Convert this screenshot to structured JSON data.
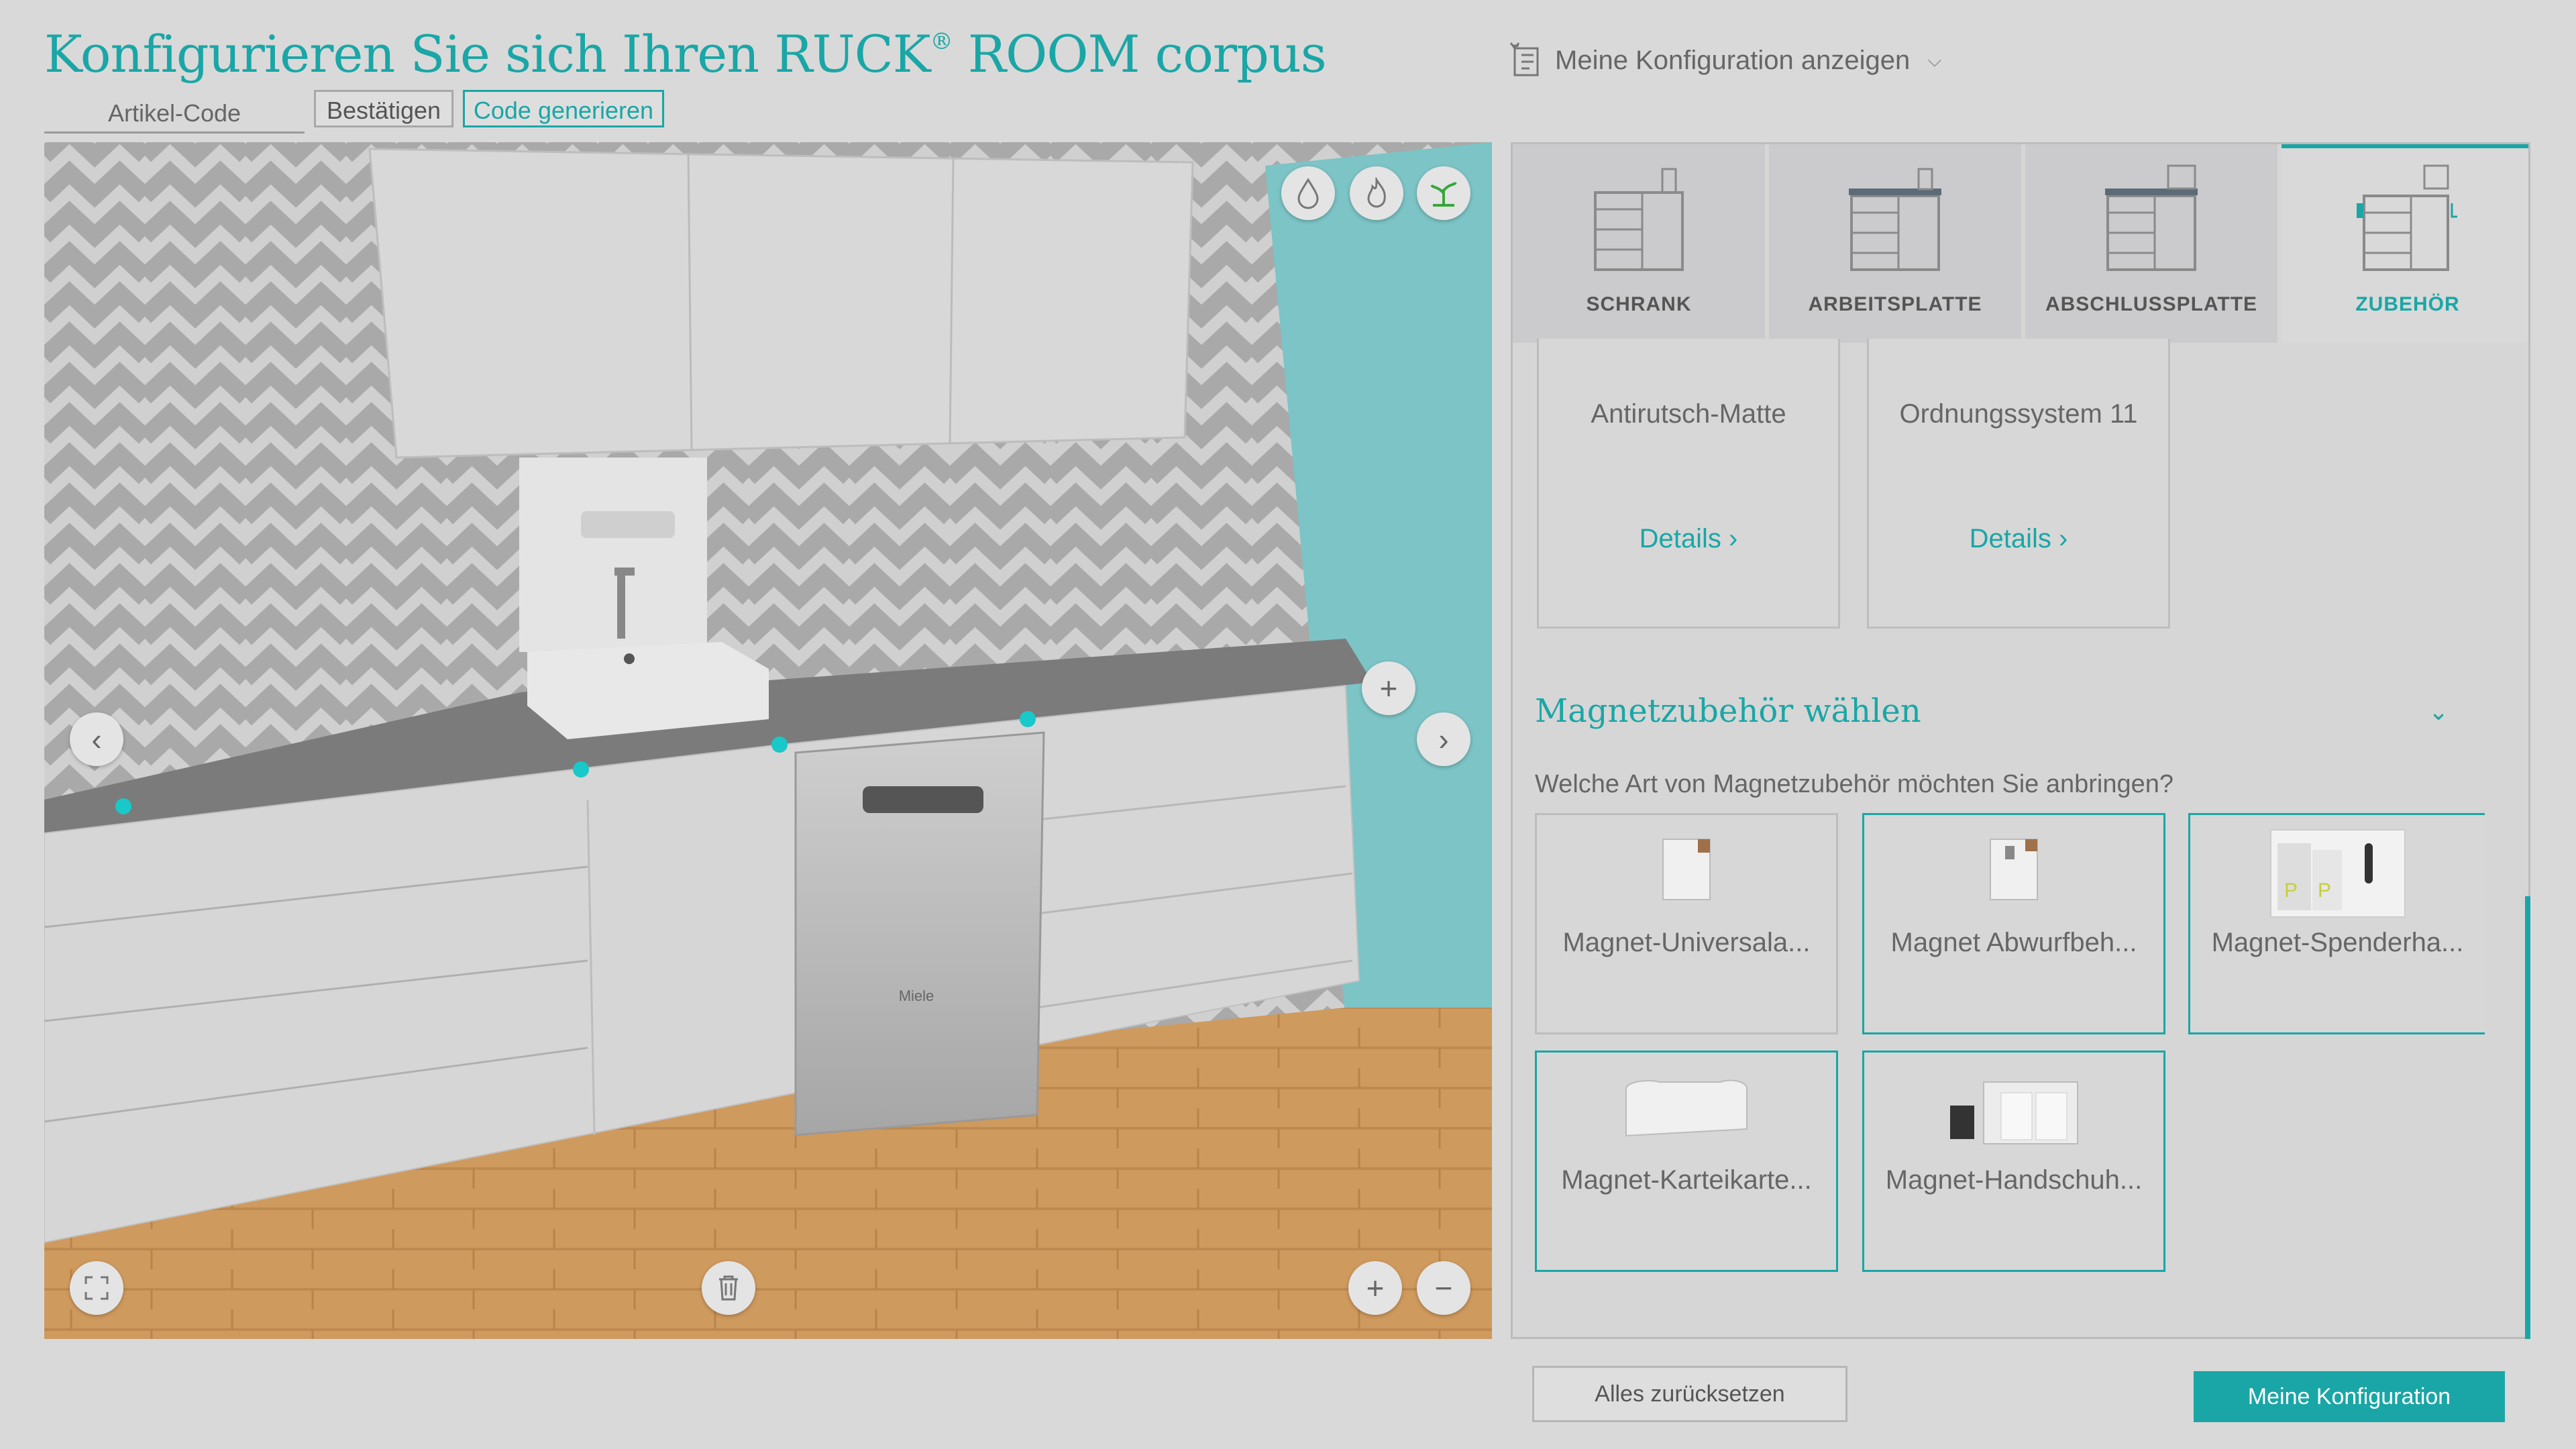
{
  "header": {
    "title_main": "Konfigurieren Sie sich Ihren RUCK",
    "title_reg": "®",
    "title_end": " ROOM corpus",
    "article_code_placeholder": "Artikel-Code",
    "confirm_label": "Bestätigen",
    "generate_code_label": "Code generieren",
    "show_config_label": "Meine Konfiguration anzeigen"
  },
  "viewer": {
    "top_icons": [
      "water-icon",
      "flame-icon",
      "plant-icon"
    ],
    "prev_icon": "chevron-left-icon",
    "next_icon": "chevron-right-icon",
    "add_icon": "plus-icon",
    "fullscreen_icon": "fullscreen-icon",
    "delete_icon": "trash-icon",
    "zoom_in_icon": "zoom-in-icon",
    "zoom_out_icon": "zoom-out-icon",
    "dishwasher_brand": "Miele"
  },
  "tabs": [
    {
      "label": "SCHRANK",
      "active": false
    },
    {
      "label": "ARBEITSPLATTE",
      "active": false
    },
    {
      "label": "ABSCHLUSSPLATTE",
      "active": false
    },
    {
      "label": "ZUBEHÖR",
      "active": true
    }
  ],
  "accessories": [
    {
      "name": "Antirutsch-Matte",
      "details": "Details"
    },
    {
      "name": "Ordnungssystem 11",
      "details": "Details"
    }
  ],
  "magnet": {
    "heading": "Magnetzubehör wählen",
    "question": "Welche Art von Magnetzubehör möchten Sie anbringen?",
    "items": [
      {
        "name": "Magnet-Universala...",
        "selected": false
      },
      {
        "name": "Magnet Abwurfbeh...",
        "selected": true
      },
      {
        "name": "Magnet-Spenderha...",
        "selected": true
      },
      {
        "name": "Magnet-Karteikarte...",
        "selected": true
      },
      {
        "name": "Magnet-Handschuh...",
        "selected": true
      }
    ]
  },
  "footer": {
    "reset_label": "Alles zurücksetzen",
    "my_config_label": "Meine Konfiguration"
  },
  "colors": {
    "accent": "#1aa6a6",
    "background": "#d9d9d9"
  }
}
